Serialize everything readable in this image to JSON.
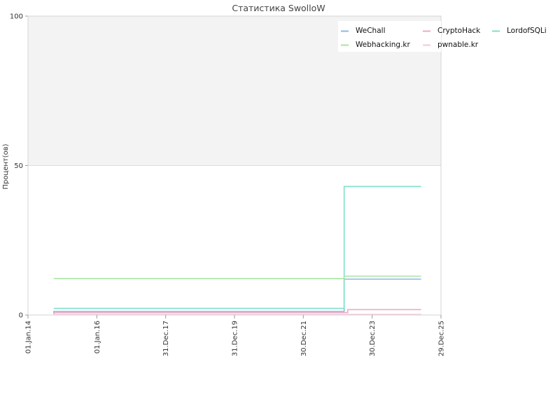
{
  "chart_data": {
    "type": "line",
    "title": "Статистика SwolloW",
    "ylabel": "Процент(ов)",
    "xlabel": "",
    "ylim": [
      0,
      100
    ],
    "yticks": [
      0,
      50,
      100
    ],
    "xlim": [
      "2014-01-01",
      "2025-12-29"
    ],
    "xticks": [
      "2014-01-01",
      "2016-01-01",
      "2017-12-31",
      "2019-12-31",
      "2021-12-30",
      "2023-12-30",
      "2025-12-29"
    ],
    "xtick_labels": [
      "01.Jan.14",
      "01.Jan.16",
      "31.Dec.17",
      "31.Dec.19",
      "30.Dec.21",
      "30.Dec.23",
      "29.Dec.25"
    ],
    "background_bands": [
      {
        "from": 50,
        "to": 100,
        "color": "#f3f3f3"
      }
    ],
    "legend_position": "top-right",
    "series": [
      {
        "name": "WeChall",
        "color": "#8fb8e6",
        "points": [
          [
            "2014-10-01",
            0.4
          ],
          [
            "2014-10-02",
            1.2
          ],
          [
            "2023-03-01",
            1.2
          ],
          [
            "2023-03-08",
            12.0
          ],
          [
            "2025-06-01",
            12.0
          ]
        ]
      },
      {
        "name": "CryptoHack",
        "color": "#f0a8c4",
        "points": [
          [
            "2014-10-01",
            0.8
          ],
          [
            "2023-03-01",
            0.8
          ],
          [
            "2023-04-15",
            1.8
          ],
          [
            "2025-06-01",
            1.8
          ]
        ]
      },
      {
        "name": "LordofSQLi",
        "color": "#7ee0c8",
        "points": [
          [
            "2014-10-01",
            2.2
          ],
          [
            "2023-03-01",
            2.2
          ],
          [
            "2023-03-08",
            43.0
          ],
          [
            "2025-06-01",
            43.0
          ]
        ]
      },
      {
        "name": "Webhacking.kr",
        "color": "#a8e6a0",
        "points": [
          [
            "2014-10-01",
            12.2
          ],
          [
            "2023-03-01",
            12.2
          ],
          [
            "2023-03-08",
            13.0
          ],
          [
            "2025-06-01",
            13.0
          ]
        ]
      },
      {
        "name": "pwnable.kr",
        "color": "#f7c6d8",
        "points": [
          [
            "2014-10-01",
            0.2
          ],
          [
            "2025-06-01",
            0.2
          ]
        ]
      }
    ]
  }
}
